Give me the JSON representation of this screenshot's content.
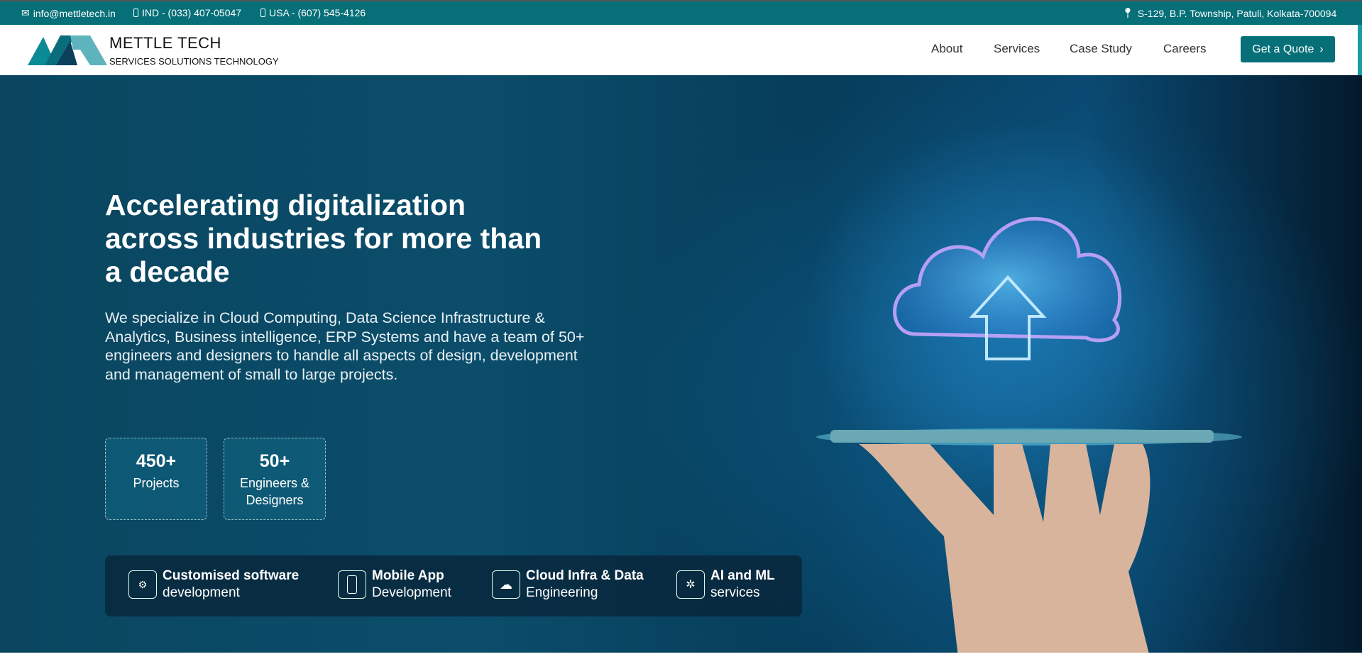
{
  "topbar": {
    "email": "info@mettletech.in",
    "phone_ind": "IND - (033) 407-05047",
    "phone_usa": "USA - (607) 545-4126",
    "address": "S-129, B.P. Township, Patuli, Kolkata-700094"
  },
  "header": {
    "brand": "METTLE TECH",
    "tagline": "SERVICES SOLUTIONS TECHNOLOGY",
    "nav": [
      "About",
      "Services",
      "Case Study",
      "Careers"
    ],
    "cta": "Get a Quote",
    "cta_icon": "chevron-right"
  },
  "hero": {
    "heading": "Accelerating digitalization across industries for more than a decade",
    "description": "We specialize in Cloud Computing, Data Science Infrastructure & Analytics, Business intelligence, ERP Systems and have a team of 50+ engineers and designers to handle all aspects of design, development and management of small to large projects.",
    "stats": [
      {
        "value": "450+",
        "label": "Projects"
      },
      {
        "value": "50+",
        "label": "Engineers & Designers"
      }
    ],
    "services": [
      {
        "title": "Customised software",
        "sub": "development",
        "icon": "software-icon"
      },
      {
        "title": "Mobile App",
        "sub": "Development",
        "icon": "mobile-icon"
      },
      {
        "title": "Cloud Infra & Data",
        "sub": "Engineering",
        "icon": "cloud-icon"
      },
      {
        "title": "AI and ML",
        "sub": "services",
        "icon": "brain-icon"
      }
    ]
  },
  "colors": {
    "brand": "#066f78",
    "hero_bg": "#0a4a63"
  }
}
